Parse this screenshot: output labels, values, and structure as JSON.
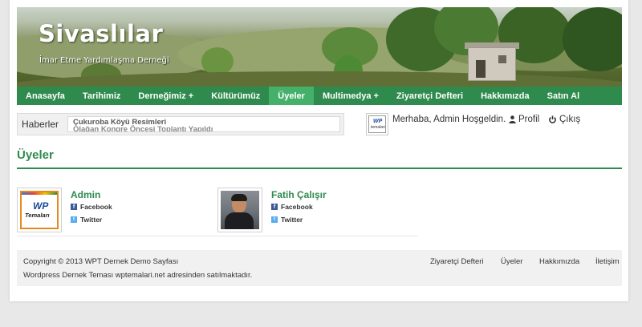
{
  "site": {
    "title": "Sivaslılar",
    "description": "İmar Etme Yardımlaşma Derneği"
  },
  "nav": [
    {
      "label": "Anasayfa"
    },
    {
      "label": "Tarihimiz"
    },
    {
      "label": "Derneğimiz +"
    },
    {
      "label": "Kültürümüz"
    },
    {
      "label": "Üyeler",
      "active": true
    },
    {
      "label": "Multimedya +"
    },
    {
      "label": "Ziyaretçi Defteri"
    },
    {
      "label": "Hakkımızda"
    },
    {
      "label": "Satın Al"
    }
  ],
  "ticker": {
    "label": "Haberler",
    "items": [
      "Çukuroba Köyü Resimleri",
      "Olağan Kongre Öncesi Toplantı Yapıldı"
    ]
  },
  "user": {
    "avatar_logo": "WP",
    "avatar_sub": "temaları",
    "greeting": "Merhaba, Admin Hoşgeldin.",
    "profile_label": "Profil",
    "profile_icon": "user-icon",
    "logout_label": "Çıkış",
    "logout_icon": "power-icon"
  },
  "page": {
    "title": "Üyeler"
  },
  "members": [
    {
      "name": "Admin",
      "avatar": "wp-logo",
      "avatar_logo": "WP",
      "avatar_sub": "Temaları",
      "facebook": "Facebook",
      "twitter": "Twitter"
    },
    {
      "name": "Fatih Çalışır",
      "avatar": "photo",
      "facebook": "Facebook",
      "twitter": "Twitter"
    }
  ],
  "footer": {
    "copyright": "Copyright © 2013 WPT Dernek Demo Sayfası",
    "credit": "Wordpress Dernek Teması wptemalari.net adresinden satılmaktadır.",
    "links": [
      "Ziyaretçi Defteri",
      "Üyeler",
      "Hakkımızda",
      "İletişim"
    ]
  },
  "colors": {
    "brand_green": "#2f8a4e",
    "active_green": "#45b06a"
  }
}
